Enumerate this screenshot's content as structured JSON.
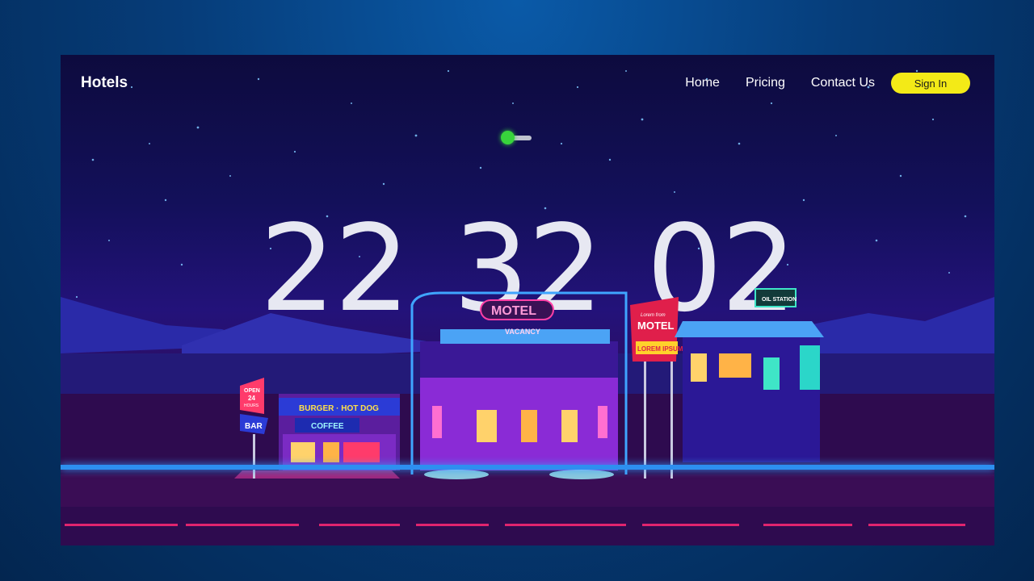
{
  "nav": {
    "logo": "Hotels",
    "links": [
      "Home",
      "Pricing",
      "Contact Us"
    ],
    "signin": "Sign In"
  },
  "toggle": {
    "state": "on",
    "color": "#38d43c"
  },
  "clock": {
    "hours": "22",
    "minutes": "32",
    "seconds": "02"
  },
  "scene": {
    "burger_sign": "BURGER · HOT DOG",
    "coffee_sign": "COFFEE",
    "open_sign_1": "OPEN",
    "open_sign_2": "24",
    "open_sign_3": "HOURS",
    "bar_sign": "BAR",
    "motel_sign": "MOTEL",
    "vacancy_sign": "VACANCY",
    "motel2_small": "Lorem from",
    "motel2_sign": "MOTEL",
    "lorem_sign": "LOREM IPSUM",
    "oil_sign": "OIL STATION"
  },
  "colors": {
    "accent": "#f3ea17",
    "sky": "#13105a",
    "neon_pink": "#ff3fa6",
    "neon_blue": "#2d8ff0"
  }
}
